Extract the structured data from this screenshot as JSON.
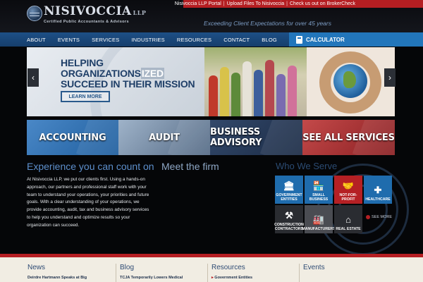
{
  "toplinks": [
    "Nisivoccia LLP Portal",
    "Upload Files To Nisivoccia",
    "Check us out on BrokerCheck"
  ],
  "logo": {
    "name": "NISIVOCCIA",
    "suffix": "LLP",
    "tagline": "Certified Public Accountants & Advisors"
  },
  "header_tagline": "Exceeding Client Expectations for over 45 years",
  "nav": [
    "ABOUT",
    "EVENTS",
    "SERVICES",
    "INDUSTRIES",
    "RESOURCES",
    "CONTACT",
    "BLOG"
  ],
  "calculator_label": "CALCULATOR",
  "hero": {
    "title_line1_a": "HELPING ORGANIZATIONS",
    "title_line1_b": "IZED",
    "title_line2": "SUCCEED IN THEIR MISSION",
    "button": "LEARN MORE"
  },
  "tiles": [
    "ACCOUNTING",
    "AUDIT",
    "BUSINESS ADVISORY",
    "SEE ALL SERVICES"
  ],
  "experience_heading": "Experience you can count on",
  "meet_heading": "Meet the firm",
  "who_heading": "Who We Serve",
  "body_text": "At Nisivoccia LLP, we put our clients first. Using a hands-on approach, our partners and professional staff work with your team to understand your operations, your priorities and future goals. With a clear understanding of your operations, we provide accounting, audit, tax and business advisory services to help you understand and optimize results so your organization can succeed.",
  "who_serve": [
    {
      "label": "GOVERNMENT ENTITIES",
      "icon": "capitol-icon",
      "glyph": "🏛"
    },
    {
      "label": "SMALL BUSINESS",
      "icon": "storefront-icon",
      "glyph": "🏪"
    },
    {
      "label": "NOT-FOR-PROFIT",
      "icon": "handshake-icon",
      "glyph": "🤝"
    },
    {
      "label": "HEALTHCARE",
      "icon": "medical-cross-icon",
      "glyph": "✚"
    },
    {
      "label": "CONSTRUCTION CONTRACTORS",
      "icon": "tools-icon",
      "glyph": "⚒"
    },
    {
      "label": "MANUFACTURERS",
      "icon": "factory-icon",
      "glyph": "🏭"
    },
    {
      "label": "REAL ESTATE",
      "icon": "house-icon",
      "glyph": "⌂"
    }
  ],
  "more_link": "SEE MORE",
  "footer": [
    {
      "heading": "News",
      "item": "Deirdre Hartmann Speaks at Big"
    },
    {
      "heading": "Blog",
      "item": "TCJA Temporarily Lowers Medical"
    },
    {
      "heading": "Resources",
      "item": "Government Entities"
    },
    {
      "heading": "Events",
      "item": ""
    }
  ],
  "colors": {
    "brand_red": "#b51e22",
    "nav_blue": "#1d4f86",
    "accent_blue": "#2276bb"
  }
}
